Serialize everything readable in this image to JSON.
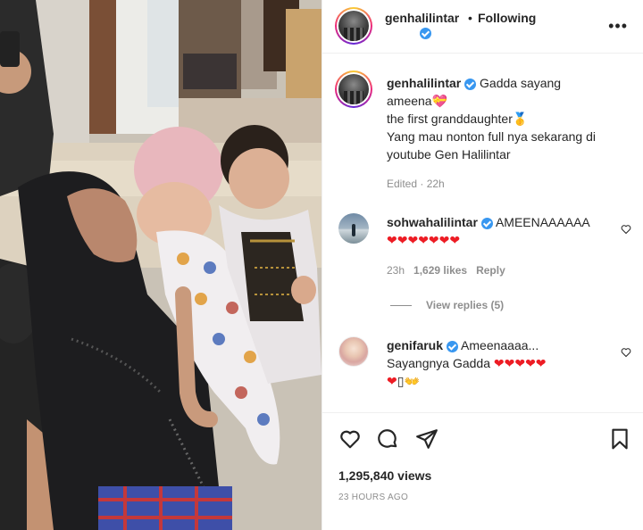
{
  "post": {
    "username": "genhalilintar",
    "separator": "•",
    "follow_status": "Following",
    "more_label": "•••",
    "caption": {
      "username": "genhalilintar",
      "line1": "Gadda sayang",
      "line2": "ameena💝",
      "line3": "the first granddaughter🥇",
      "line4": "Yang mau nonton full nya sekarang di",
      "line5": "youtube Gen Halilintar"
    },
    "caption_meta": "Edited · 22h"
  },
  "comments": [
    {
      "username": "sohwahalilintar",
      "text": "AMEENAAAAAA",
      "hearts": "❤❤❤❤❤❤❤",
      "age": "23h",
      "likes": "1,629 likes",
      "reply_label": "Reply",
      "view_replies": "View replies (5)"
    },
    {
      "username": "genifaruk",
      "text": "Ameenaaaa...",
      "line2": "Sayangnya Gadda",
      "hearts": "❤❤❤❤❤",
      "line3_hearts": "❤",
      "line3_tail": "▯👐"
    }
  ],
  "stats": {
    "views": "1,295,840 views",
    "timestamp": "23 HOURS AGO"
  },
  "icons": {
    "like": "heart-outline-icon",
    "comment": "comment-bubble-icon",
    "share": "paper-plane-icon",
    "save": "bookmark-icon",
    "verified": "verified-badge-icon"
  },
  "colors": {
    "verified": "#3897f0",
    "heart": "#ed1c24",
    "muted": "#8e8e8e",
    "text": "#262626"
  }
}
